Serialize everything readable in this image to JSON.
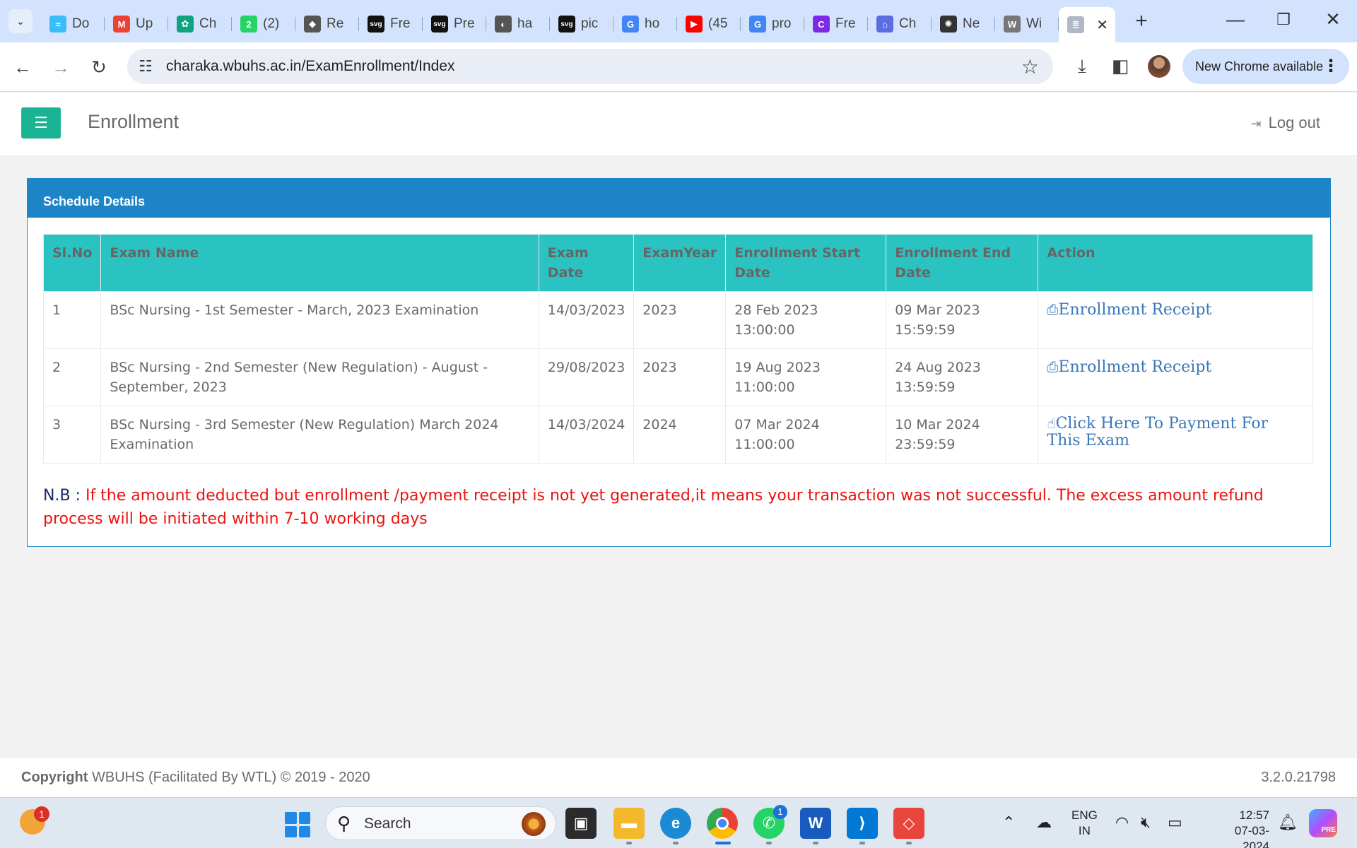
{
  "browser": {
    "tabs": [
      {
        "label": "Do",
        "icon": "tailwind-icon",
        "color": "#38bdf8",
        "glyph": "≈"
      },
      {
        "label": "Up",
        "icon": "gmail-icon",
        "color": "#ea4335",
        "glyph": "M"
      },
      {
        "label": "Ch",
        "icon": "chatgpt-icon",
        "color": "#10a37f",
        "glyph": "✿"
      },
      {
        "label": "(2)",
        "icon": "whatsapp-icon",
        "color": "#25d366",
        "glyph": "2"
      },
      {
        "label": "Re",
        "icon": "stack-icon",
        "color": "#555555",
        "glyph": "◆"
      },
      {
        "label": "Fre",
        "icon": "svg-repo-icon",
        "color": "#111111",
        "glyph": "svg"
      },
      {
        "label": "Pre",
        "icon": "svg-repo-icon",
        "color": "#111111",
        "glyph": "svg"
      },
      {
        "label": "ha",
        "icon": "globe-icon",
        "color": "#555555",
        "glyph": "◐"
      },
      {
        "label": "pic",
        "icon": "svg-repo-icon",
        "color": "#111111",
        "glyph": "svg"
      },
      {
        "label": "ho",
        "icon": "google-icon",
        "color": "#4285f4",
        "glyph": "G"
      },
      {
        "label": "(45",
        "icon": "youtube-icon",
        "color": "#ff0000",
        "glyph": "▶"
      },
      {
        "label": "pro",
        "icon": "google-icon",
        "color": "#4285f4",
        "glyph": "G"
      },
      {
        "label": "Fre",
        "icon": "canva-icon",
        "color": "#7d2ae8",
        "glyph": "C"
      },
      {
        "label": "Ch",
        "icon": "chrome-ext-icon",
        "color": "#5b6ee1",
        "glyph": "⌂"
      },
      {
        "label": "Ne",
        "icon": "openai-icon",
        "color": "#333333",
        "glyph": "✺"
      },
      {
        "label": "Wi",
        "icon": "wiki-icon",
        "color": "#777777",
        "glyph": "W"
      },
      {
        "label": "",
        "icon": "document-icon",
        "color": "#b0b8c8",
        "glyph": "≣",
        "active": true
      }
    ],
    "url": "charaka.wbuhs.ac.in/ExamEnrollment/Index",
    "update_label": "New Chrome available"
  },
  "header": {
    "title": "Enrollment",
    "logout_label": "Log out"
  },
  "panel": {
    "heading": "Schedule Details",
    "columns": [
      "Sl.No",
      "Exam Name",
      "Exam Date",
      "ExamYear",
      "Enrollment Start Date",
      "Enrollment End Date",
      "Action"
    ],
    "rows": [
      {
        "sl": "1",
        "name": "BSc Nursing - 1st Semester - March, 2023 Examination",
        "exam_date": "14/03/2023",
        "year": "2023",
        "start": "28 Feb 2023 13:00:00",
        "end": "09 Mar 2023 15:59:59",
        "action": "Enrollment Receipt",
        "action_icon": "printer-icon"
      },
      {
        "sl": "2",
        "name": "BSc Nursing - 2nd Semester (New Regulation) - August - September, 2023",
        "exam_date": "29/08/2023",
        "year": "2023",
        "start": "19 Aug 2023 11:00:00",
        "end": "24 Aug 2023 13:59:59",
        "action": "Enrollment Receipt",
        "action_icon": "printer-icon"
      },
      {
        "sl": "3",
        "name": "BSc Nursing - 3rd Semester (New Regulation) March 2024 Examination",
        "exam_date": "14/03/2024",
        "year": "2024",
        "start": "07 Mar 2024 11:00:00",
        "end": "10 Mar 2024 23:59:59",
        "action": "Click Here To Payment For This Exam",
        "action_icon": "hand-pointer-icon"
      }
    ],
    "note_prefix": "N.B : ",
    "note_text": "If the amount deducted but enrollment /payment receipt is not yet generated,it means your transaction was not successful. The excess amount refund process will be initiated within 7-10 working days"
  },
  "footer": {
    "copyright_bold": "Copyright",
    "copyright_text": " WBUHS (Facilitated By WTL) © 2019 - 2020",
    "version": "3.2.0.21798"
  },
  "taskbar": {
    "weather_badge": "1",
    "search_label": "Search",
    "whatsapp_badge": "1",
    "lang_top": "ENG",
    "lang_bottom": "IN",
    "time": "12:57",
    "date": "07-03-2024",
    "copilot_label": "PRE"
  },
  "colors": {
    "accent": "#1ab394",
    "panel_heading": "#1e84c8",
    "table_header": "#2bc3c1",
    "warning_text": "#ee1111",
    "link": "#3a78b8"
  }
}
